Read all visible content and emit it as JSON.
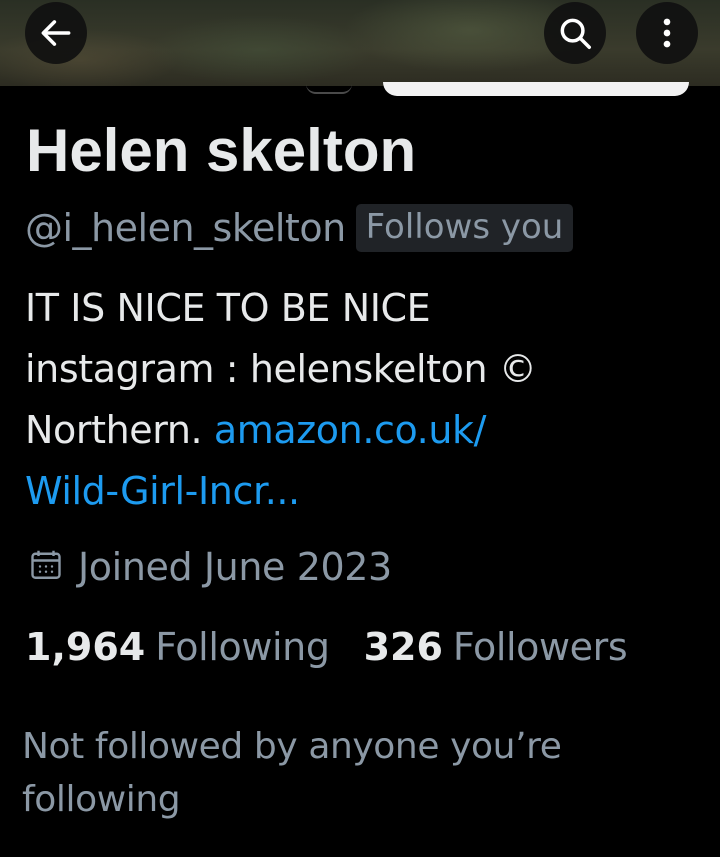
{
  "header": {
    "back_icon": "arrow-left-icon",
    "search_icon": "search-icon",
    "more_icon": "more-vertical-icon"
  },
  "profile": {
    "name": "Helen skelton",
    "handle": "@i_helen_skelton",
    "follows_you_badge": "Follows you",
    "bio": {
      "line1": "IT IS NICE TO BE NICE",
      "line2": "instagram : helenskelton ©",
      "line3_text": "Northern. ",
      "line3_link": "amazon.co.uk/",
      "line4_link": "Wild-Girl-Incr..."
    },
    "joined": "Joined June 2023",
    "joined_icon": "calendar-icon",
    "following_count": "1,964",
    "following_label": "Following",
    "followers_count": "326",
    "followers_label": "Followers",
    "mutuals_text": "Not followed by anyone you’re following"
  },
  "colors": {
    "background": "#000000",
    "primary_text": "#e7e9ea",
    "secondary_text": "#8b98a5",
    "link": "#1d9bf0",
    "badge_bg": "#202327"
  }
}
